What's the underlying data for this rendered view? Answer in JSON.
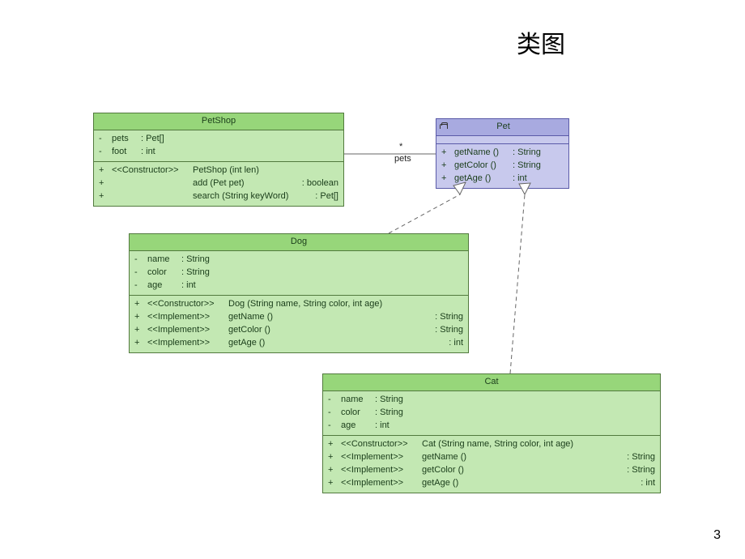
{
  "title": "类图",
  "page_number": "3",
  "assoc": {
    "mult": "*",
    "role": "pets"
  },
  "classes": {
    "petshop": {
      "name": "PetShop",
      "attrs": [
        {
          "vis": "-",
          "name": "pets",
          "type": "Pet[]"
        },
        {
          "vis": "-",
          "name": "foot",
          "type": "int"
        }
      ],
      "ops": [
        {
          "vis": "+",
          "stereo": "<<Constructor>>",
          "sig": "PetShop (int len)",
          "ret": ""
        },
        {
          "vis": "+",
          "stereo": "",
          "sig": "add (Pet pet)",
          "ret": ": boolean"
        },
        {
          "vis": "+",
          "stereo": "",
          "sig": "search (String keyWord)",
          "ret": ": Pet[]"
        }
      ]
    },
    "pet": {
      "name": "Pet",
      "ops": [
        {
          "vis": "+",
          "sig": "getName ()",
          "ret": ": String"
        },
        {
          "vis": "+",
          "sig": "getColor ()",
          "ret": ": String"
        },
        {
          "vis": "+",
          "sig": "getAge ()",
          "ret": ": int"
        }
      ]
    },
    "dog": {
      "name": "Dog",
      "attrs": [
        {
          "vis": "-",
          "name": "name",
          "type": "String"
        },
        {
          "vis": "-",
          "name": "color",
          "type": "String"
        },
        {
          "vis": "-",
          "name": "age",
          "type": "int"
        }
      ],
      "ops": [
        {
          "vis": "+",
          "stereo": "<<Constructor>>",
          "sig": "Dog (String name, String color, int age)",
          "ret": ""
        },
        {
          "vis": "+",
          "stereo": "<<Implement>>",
          "sig": "getName ()",
          "ret": ": String"
        },
        {
          "vis": "+",
          "stereo": "<<Implement>>",
          "sig": "getColor ()",
          "ret": ": String"
        },
        {
          "vis": "+",
          "stereo": "<<Implement>>",
          "sig": "getAge ()",
          "ret": ": int"
        }
      ]
    },
    "cat": {
      "name": "Cat",
      "attrs": [
        {
          "vis": "-",
          "name": "name",
          "type": "String"
        },
        {
          "vis": "-",
          "name": "color",
          "type": "String"
        },
        {
          "vis": "-",
          "name": "age",
          "type": "int"
        }
      ],
      "ops": [
        {
          "vis": "+",
          "stereo": "<<Constructor>>",
          "sig": "Cat (String name, String color, int age)",
          "ret": ""
        },
        {
          "vis": "+",
          "stereo": "<<Implement>>",
          "sig": "getName ()",
          "ret": ": String"
        },
        {
          "vis": "+",
          "stereo": "<<Implement>>",
          "sig": "getColor ()",
          "ret": ": String"
        },
        {
          "vis": "+",
          "stereo": "<<Implement>>",
          "sig": "getAge ()",
          "ret": ": int"
        }
      ]
    }
  }
}
